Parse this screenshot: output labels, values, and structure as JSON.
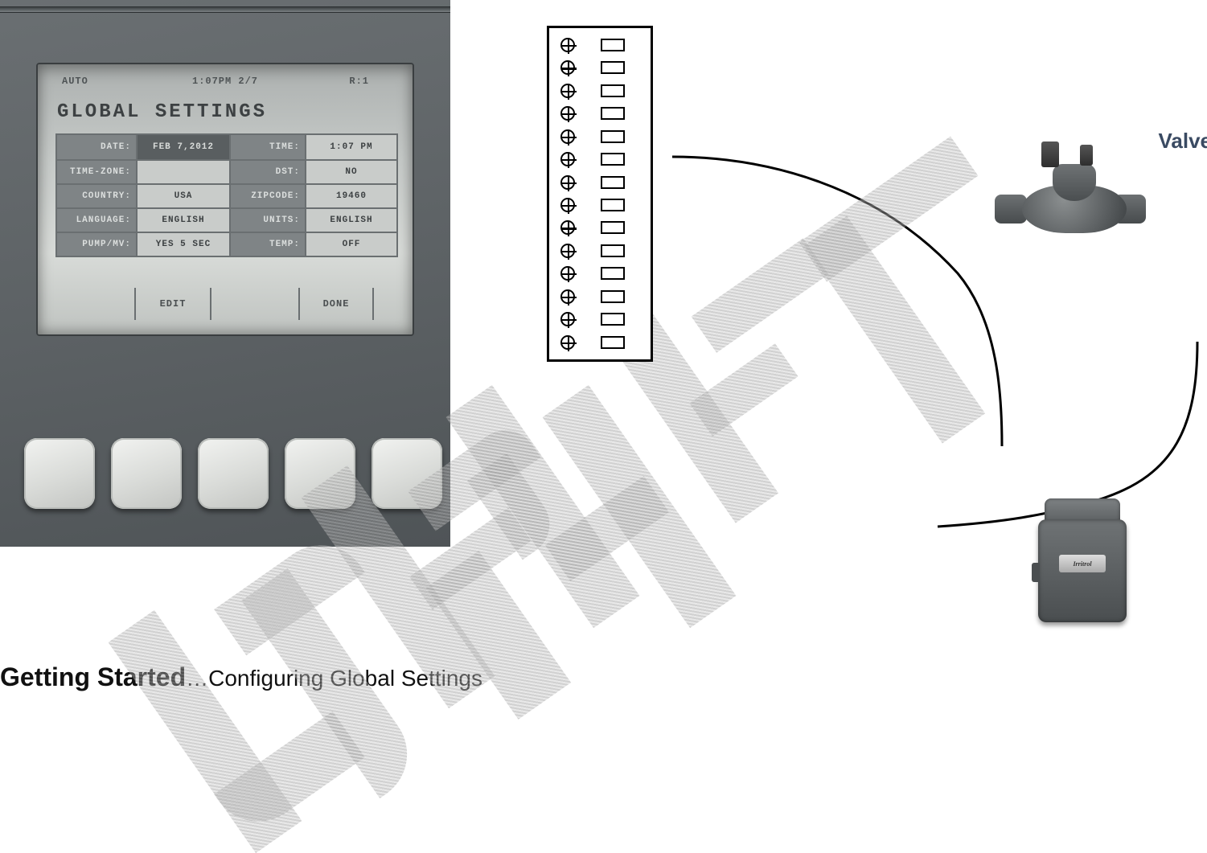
{
  "controller": {
    "status": {
      "mode": "AUTO",
      "clock": "1:07PM 2/7",
      "r": "R:1"
    },
    "title": "GLOBAL SETTINGS",
    "rows": [
      {
        "l1": "DATE:",
        "v1": "FEB  7,2012",
        "l2": "TIME:",
        "v2": "1:07 PM",
        "selected": true
      },
      {
        "l1": "TIME-ZONE:",
        "v1": "",
        "l2": "DST:",
        "v2": "NO"
      },
      {
        "l1": "COUNTRY:",
        "v1": "USA",
        "l2": "ZIPCODE:",
        "v2": "19460"
      },
      {
        "l1": "LANGUAGE:",
        "v1": "ENGLISH",
        "l2": "UNITS:",
        "v2": "ENGLISH"
      },
      {
        "l1": "PUMP/MV:",
        "v1": "YES 5 SEC",
        "l2": "TEMP:",
        "v2": "OFF"
      }
    ],
    "softkeys": {
      "edit": "EDIT",
      "done": "DONE"
    }
  },
  "terminal_rows": 14,
  "valve_label": "Valve",
  "sensor_brand": "Irritrol",
  "caption": {
    "bold": "Getting Started",
    "rest": "…Configuring Global Settings"
  }
}
